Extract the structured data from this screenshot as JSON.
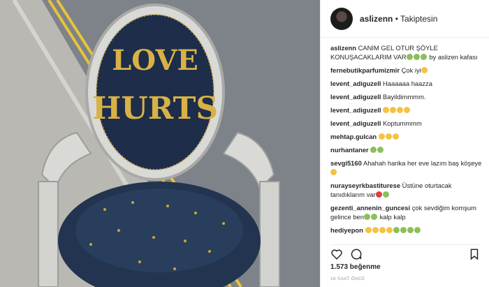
{
  "photo": {
    "text_top": "LOVE",
    "text_bottom": "HURTS"
  },
  "header": {
    "username": "aslizenn",
    "separator": "•",
    "follow_status": "Takiptesin"
  },
  "comments": [
    {
      "user": "aslizenn",
      "text": "CANIM GEL OTUR ŞÖYLE KONUŞACAKLARIM VAR",
      "emoji_after": [
        "g",
        "g",
        "g"
      ],
      "tail": "by aslizen kafası"
    },
    {
      "user": "fernebutikparfumizmir",
      "text": "Çok iyi",
      "emoji_after": [
        "y"
      ],
      "tail": ""
    },
    {
      "user": "levent_adiguzell",
      "text": "Haaaaaa haazza",
      "emoji_after": [],
      "tail": ""
    },
    {
      "user": "levent_adiguzell",
      "text": "Bayildimmmm.",
      "emoji_after": [],
      "tail": ""
    },
    {
      "user": "levent_adiguzell",
      "text": "",
      "emoji_after": [
        "y",
        "y",
        "y",
        "y"
      ],
      "tail": ""
    },
    {
      "user": "levent_adiguzell",
      "text": "Koptummmm",
      "emoji_after": [],
      "tail": ""
    },
    {
      "user": "mehtap.gulcan",
      "text": "",
      "emoji_after": [
        "y",
        "y",
        "y"
      ],
      "tail": ""
    },
    {
      "user": "nurhantaner",
      "text": "",
      "emoji_after": [
        "g",
        "g"
      ],
      "tail": ""
    },
    {
      "user": "sevgi5160",
      "text": "Ahahah harika her eve lazım baş köşeye",
      "emoji_after": [
        "y"
      ],
      "tail": ""
    },
    {
      "user": "nurayseyrkbastiturese",
      "text": "Üstüne oturtacak tanıdıklarım var",
      "emoji_after": [
        "r",
        "g"
      ],
      "tail": ""
    },
    {
      "user": "gezenti_annenin_guncesi",
      "text": "çok sevdiğim komşum gelince ben",
      "emoji_after": [
        "g",
        "g"
      ],
      "tail": "kalp kalp"
    },
    {
      "user": "hediyepon",
      "text": "",
      "emoji_after": [
        "y",
        "y",
        "y",
        "y",
        "g",
        "g",
        "g",
        "g"
      ],
      "tail": ""
    }
  ],
  "likes": "1.573 beğenme",
  "timestamp": "16 SAAT ÖNCE"
}
